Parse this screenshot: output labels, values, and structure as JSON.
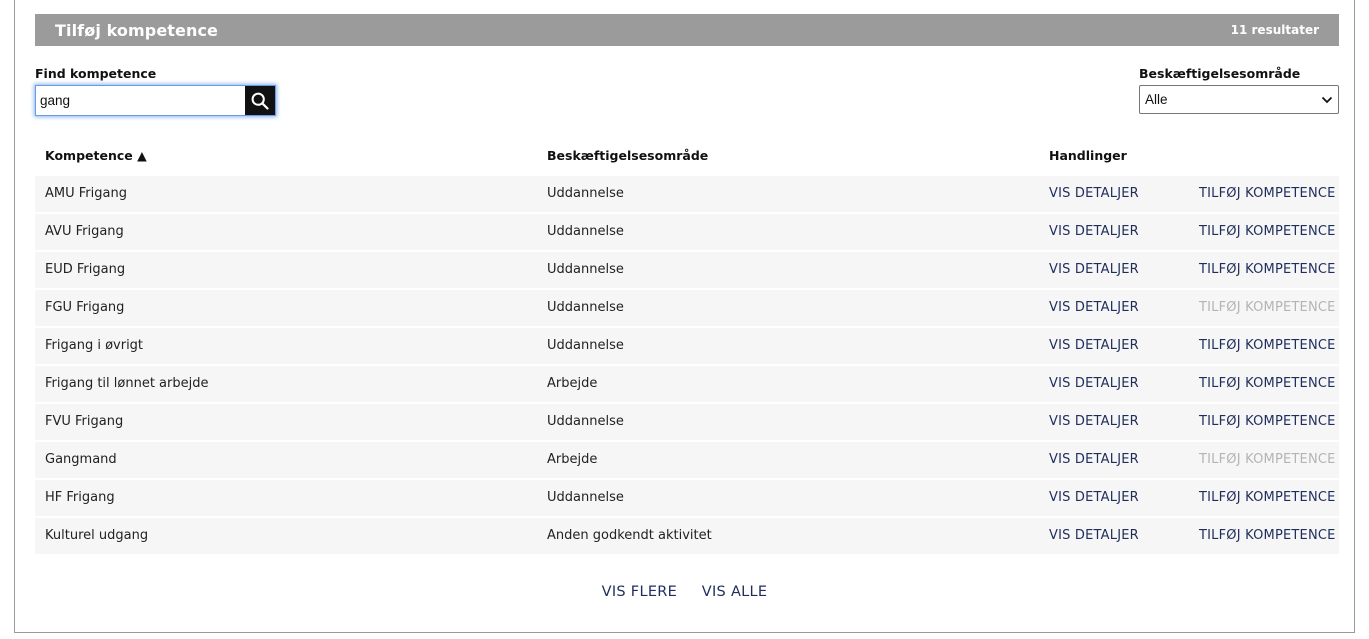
{
  "header": {
    "title": "Tilføj kompetence",
    "result_count": "11 resultater"
  },
  "search": {
    "label": "Find kompetence",
    "value": "gang",
    "icon": "search-icon"
  },
  "filter": {
    "label": "Beskæftigelsesområde",
    "selected": "Alle"
  },
  "columns": {
    "name": "Kompetence ▲",
    "area": "Beskæftigelsesområde",
    "actions": "Handlinger"
  },
  "rows": [
    {
      "name": "AMU Frigang",
      "area": "Uddannelse",
      "details": "VIS DETALJER",
      "add": "TILFØJ KOMPETENCE",
      "add_enabled": true
    },
    {
      "name": "AVU Frigang",
      "area": "Uddannelse",
      "details": "VIS DETALJER",
      "add": "TILFØJ KOMPETENCE",
      "add_enabled": true
    },
    {
      "name": "EUD Frigang",
      "area": "Uddannelse",
      "details": "VIS DETALJER",
      "add": "TILFØJ KOMPETENCE",
      "add_enabled": true
    },
    {
      "name": "FGU Frigang",
      "area": "Uddannelse",
      "details": "VIS DETALJER",
      "add": "TILFØJ KOMPETENCE",
      "add_enabled": false
    },
    {
      "name": "Frigang i øvrigt",
      "area": "Uddannelse",
      "details": "VIS DETALJER",
      "add": "TILFØJ KOMPETENCE",
      "add_enabled": true
    },
    {
      "name": "Frigang til lønnet arbejde",
      "area": "Arbejde",
      "details": "VIS DETALJER",
      "add": "TILFØJ KOMPETENCE",
      "add_enabled": true
    },
    {
      "name": "FVU Frigang",
      "area": "Uddannelse",
      "details": "VIS DETALJER",
      "add": "TILFØJ KOMPETENCE",
      "add_enabled": true
    },
    {
      "name": "Gangmand",
      "area": "Arbejde",
      "details": "VIS DETALJER",
      "add": "TILFØJ KOMPETENCE",
      "add_enabled": false
    },
    {
      "name": "HF Frigang",
      "area": "Uddannelse",
      "details": "VIS DETALJER",
      "add": "TILFØJ KOMPETENCE",
      "add_enabled": true
    },
    {
      "name": "Kulturel udgang",
      "area": "Anden godkendt aktivitet",
      "details": "VIS DETALJER",
      "add": "TILFØJ KOMPETENCE",
      "add_enabled": true
    }
  ],
  "footer": {
    "show_more": "VIS FLERE",
    "show_all": "VIS ALLE"
  },
  "colors": {
    "header_bg": "#9b9b9b",
    "link": "#1f2d5c",
    "disabled_link": "#b4b4b4",
    "row_bg": "#f6f6f6"
  }
}
